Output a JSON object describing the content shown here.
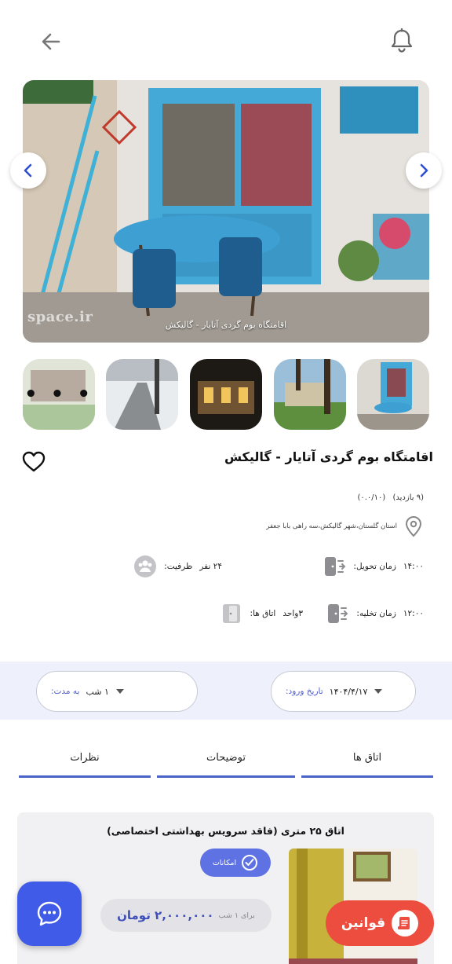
{
  "hero": {
    "caption": "اقامتگاه بوم گردی آتایار - گالیکش",
    "watermark": "space.ir"
  },
  "gallery": {
    "more_indicator": "• • •"
  },
  "listing": {
    "title": "اقامتگاه بوم گردی آتایار - گالیکش",
    "visits": "(۹ بازدید)",
    "rating": "(۰.۰/۱۰)",
    "address": "استان گلستان،شهر گالیکش،سه راهی بابا جعفر",
    "checkin_label": "زمان تحویل:",
    "checkin_value": "۱۴:۰۰",
    "capacity_label": "ظرفیت:",
    "capacity_value": "۲۴ نفر",
    "checkout_label": "زمان تخلیه:",
    "checkout_value": "۱۲:۰۰",
    "rooms_label": "اتاق ها:",
    "rooms_value": "۳واحد"
  },
  "booking": {
    "date_label": "تاریخ ورود:",
    "date_value": "۱۴۰۴/۴/۱۷",
    "duration_label": "به مدت:",
    "duration_value": "۱ شب"
  },
  "tabs": {
    "rooms": "اتاق ها",
    "description": "توضیحات",
    "reviews": "نظرات"
  },
  "room": {
    "title": "اتاق ۲۵ متری (فاقد سرویس بهداشتی اختصاصی)",
    "amenities_button": "امکانات",
    "price": "۲,۰۰۰,۰۰۰ تومان",
    "per": "برای ۱ شب"
  },
  "rules_button": "قوانین",
  "colors": {
    "accent": "#4a63c9",
    "fab": "#3f5be8",
    "rules": "#ec4d3f",
    "booking_bg": "#eef1fb"
  },
  "icons": {
    "back": "arrow-left-icon",
    "bell": "bell-icon",
    "fav": "heart-icon",
    "location": "location-pin-icon",
    "chat": "chat-bubble-icon"
  }
}
